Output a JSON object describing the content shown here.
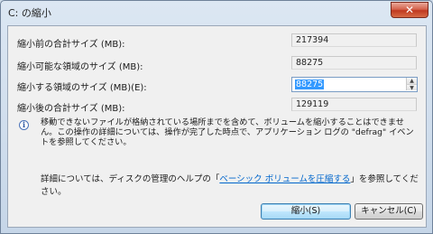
{
  "window": {
    "title": "C: の縮小",
    "close_glyph": "✕"
  },
  "fields": [
    {
      "label": "縮小前の合計サイズ (MB):",
      "value": "217394"
    },
    {
      "label": "縮小可能な領域のサイズ (MB):",
      "value": "88275"
    },
    {
      "label": "縮小する領域のサイズ (MB)(E):",
      "value": "88275"
    },
    {
      "label": "縮小後の合計サイズ (MB):",
      "value": "129119"
    }
  ],
  "info": {
    "icon": "info-icon",
    "icon_glyph": "i",
    "text": "移動できないファイルが格納されている場所までを含めて、ボリュームを縮小することはできません。この操作の詳細については、操作が完了した時点で、アプリケーション ログの \"defrag\" イベントを参照してください。"
  },
  "help": {
    "prefix": "詳細については、ディスクの管理のヘルプの「",
    "link": "ベーシック ボリュームを圧縮する",
    "suffix": "」を参照してください。"
  },
  "buttons": {
    "shrink": "縮小(S)",
    "cancel": "キャンセル(C)"
  },
  "spinner": {
    "up": "▲",
    "down": "▼"
  }
}
